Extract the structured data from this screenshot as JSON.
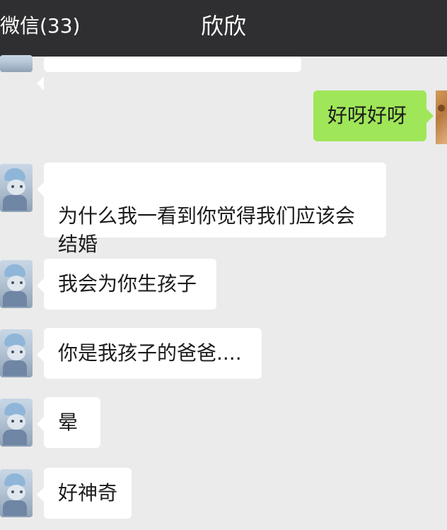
{
  "header": {
    "back_label": "微信(33)",
    "title": "欣欣"
  },
  "messages": [
    {
      "from": "contact",
      "text": ""
    },
    {
      "from": "me",
      "text": "好呀好呀"
    },
    {
      "from": "contact",
      "text": "为什么我一看到你觉得我们应该会\n结婚"
    },
    {
      "from": "contact",
      "text": "我会为你生孩子"
    },
    {
      "from": "contact",
      "text": "你是我孩子的爸爸...."
    },
    {
      "from": "contact",
      "text": "晕"
    },
    {
      "from": "contact",
      "text": "好神奇"
    }
  ],
  "colors": {
    "header_bg": "#2f2f31",
    "chat_bg": "#ebebeb",
    "my_bubble": "#9fe658",
    "their_bubble": "#ffffff"
  },
  "icons": {
    "contact_avatar": "cat-avatar-icon",
    "my_avatar": "cat-avatar-icon"
  }
}
